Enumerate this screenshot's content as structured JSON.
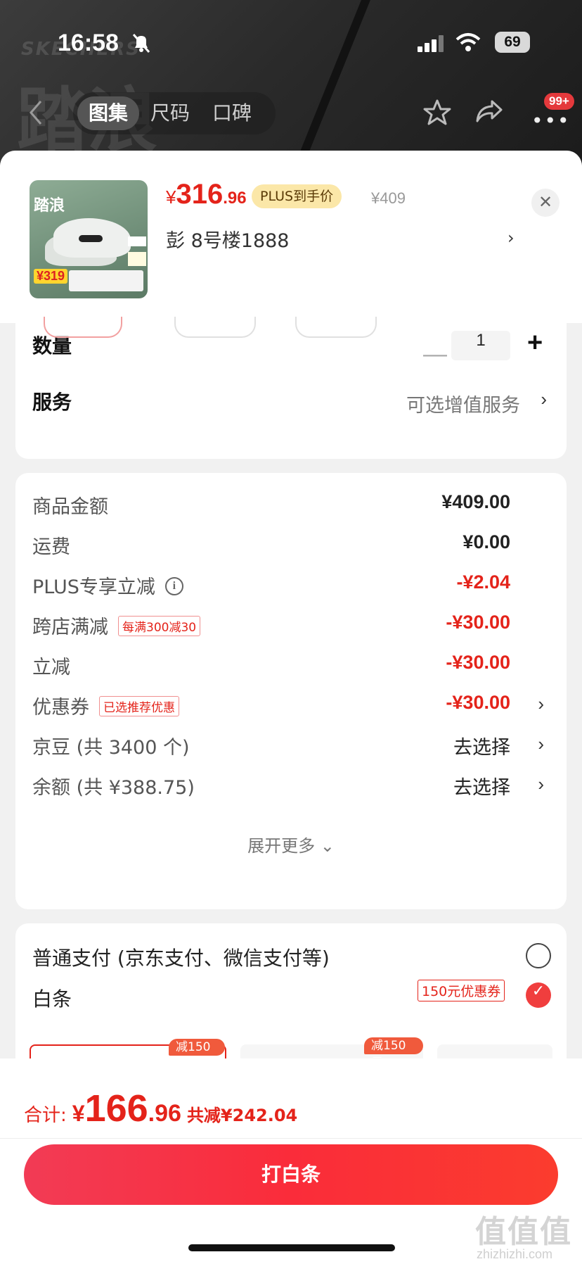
{
  "status_bar": {
    "time": "16:58",
    "battery": "69"
  },
  "header": {
    "brand_watermark": "SKECHERS",
    "product_watermark": "踏浪",
    "tabs": [
      {
        "label": "图集",
        "active": true
      },
      {
        "label": "尺码",
        "active": false
      },
      {
        "label": "口碑",
        "active": false
      }
    ],
    "more_badge": "99+"
  },
  "product": {
    "thumb_title": "踏浪",
    "thumb_price": "¥319",
    "price_currency": "¥",
    "price_int": "316",
    "price_dec": ".96",
    "plus_tag": "PLUS到手价",
    "original_price": "¥409",
    "address": "彭  8号楼1888"
  },
  "options": {
    "qty_label": "数量",
    "qty_value": "1",
    "service_label": "服务",
    "service_value": "可选增值服务"
  },
  "breakdown": {
    "rows": [
      {
        "label": "商品金额",
        "value": "¥409.00",
        "red": false
      },
      {
        "label": "运费",
        "value": "¥0.00",
        "red": false
      },
      {
        "label": "PLUS专享立减",
        "value": "-¥2.04",
        "red": true
      },
      {
        "label": "跨店满减",
        "tag": "每满300减30",
        "value": "-¥30.00",
        "red": true
      },
      {
        "label": "立减",
        "value": "-¥30.00",
        "red": true
      },
      {
        "label": "优惠券",
        "tag": "已选推荐优惠",
        "value": "-¥30.00",
        "red": true
      }
    ],
    "jingdou_label": "京豆 (共 3400 个)",
    "jingdou_action": "去选择",
    "balance_label": "余额 (共 ¥388.75)",
    "balance_action": "去选择",
    "expand": "展开更多"
  },
  "payment": {
    "normal": "普通支付 (京东支付、微信支付等)",
    "baitiao": "白条",
    "coupon": "150元优惠券",
    "plan_badge_1": "减150元",
    "plan_badge_2": "减150元"
  },
  "footer": {
    "total_label": "合计:",
    "currency": "¥",
    "total_int": "166",
    "total_dec": ".96",
    "saved": "共减¥242.04",
    "pay_button": "打白条"
  },
  "watermark": {
    "logo": "值值值",
    "url": "zhizhizhi.com"
  },
  "colors": {
    "accent": "#e4231a",
    "button": "#fa2c3a",
    "plus_tag_bg": "#fbe7a8"
  }
}
